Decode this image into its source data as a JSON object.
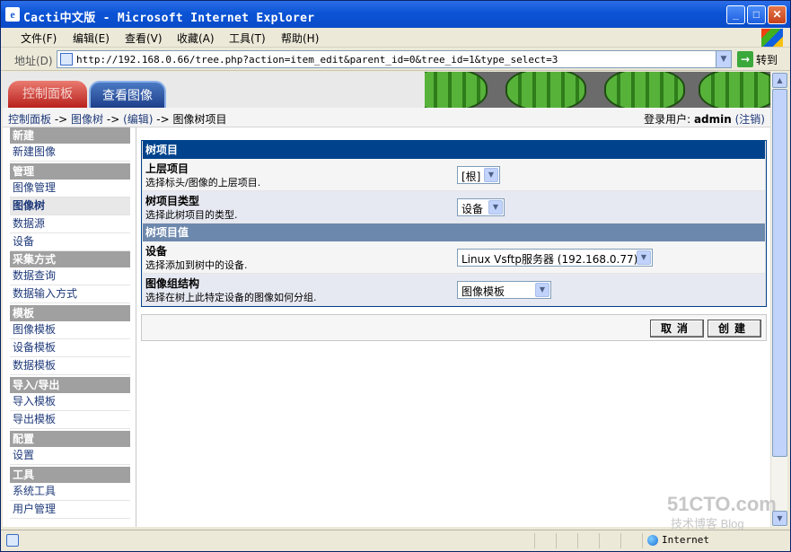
{
  "window": {
    "title": "Cacti中文版 - Microsoft Internet Explorer",
    "min_label": "_",
    "max_label": "□",
    "close_label": "✕"
  },
  "menu": {
    "items": [
      "文件(F)",
      "编辑(E)",
      "查看(V)",
      "收藏(A)",
      "工具(T)",
      "帮助(H)"
    ]
  },
  "address": {
    "label": "地址(D)",
    "url": "http://192.168.0.66/tree.php?action=item_edit&parent_id=0&tree_id=1&type_select=3",
    "go_label": "转到"
  },
  "tabs": {
    "console": "控制面板",
    "graphs": "查看图像"
  },
  "breadcrumb": {
    "c1": "控制面板",
    "sep1": " -> ",
    "c2": "图像树",
    "sep2": " -> ",
    "c3": "(编辑)",
    "sep3": " -> ",
    "c4": "图像树项目"
  },
  "user": {
    "prefix": "登录用户: ",
    "name": "admin",
    "logout": "(注销)"
  },
  "sidebar": {
    "sections": [
      "新建",
      "管理",
      "采集方式",
      "模板",
      "导入/导出",
      "配置",
      "工具"
    ],
    "items": [
      "新建图像",
      "图像管理",
      "图像树",
      "数据源",
      "设备",
      "数据查询",
      "数据输入方式",
      "图像模板",
      "设备模板",
      "数据模板",
      "导入模板",
      "导出模板",
      "设置",
      "系统工具",
      "用户管理"
    ],
    "selected": "图像树"
  },
  "form": {
    "header": "树项目",
    "parent_title": "上层项目",
    "parent_desc": "选择标头/图像的上层项目.",
    "parent_value": "[根]",
    "type_title": "树项目类型",
    "type_desc": "选择此树项目的类型.",
    "type_value": "设备",
    "value_header": "树项目值",
    "host_title": "设备",
    "host_desc": "选择添加到树中的设备.",
    "host_value": "Linux Vsftp服务器 (192.168.0.77)",
    "group_title": "图像组结构",
    "group_desc": "选择在树上此特定设备的图像如何分组.",
    "group_value": "图像模板"
  },
  "buttons": {
    "cancel": "取消",
    "create": "创建"
  },
  "status": {
    "zone": "Internet"
  },
  "watermark": {
    "main": "51CTO.com",
    "sub": "技术博客  Blog"
  },
  "colors": {
    "title_bar": "#0b54d6",
    "panel_header": "#00438c",
    "panel_subheader": "#6d88ad",
    "sidebar_section": "#a0a0a0"
  }
}
